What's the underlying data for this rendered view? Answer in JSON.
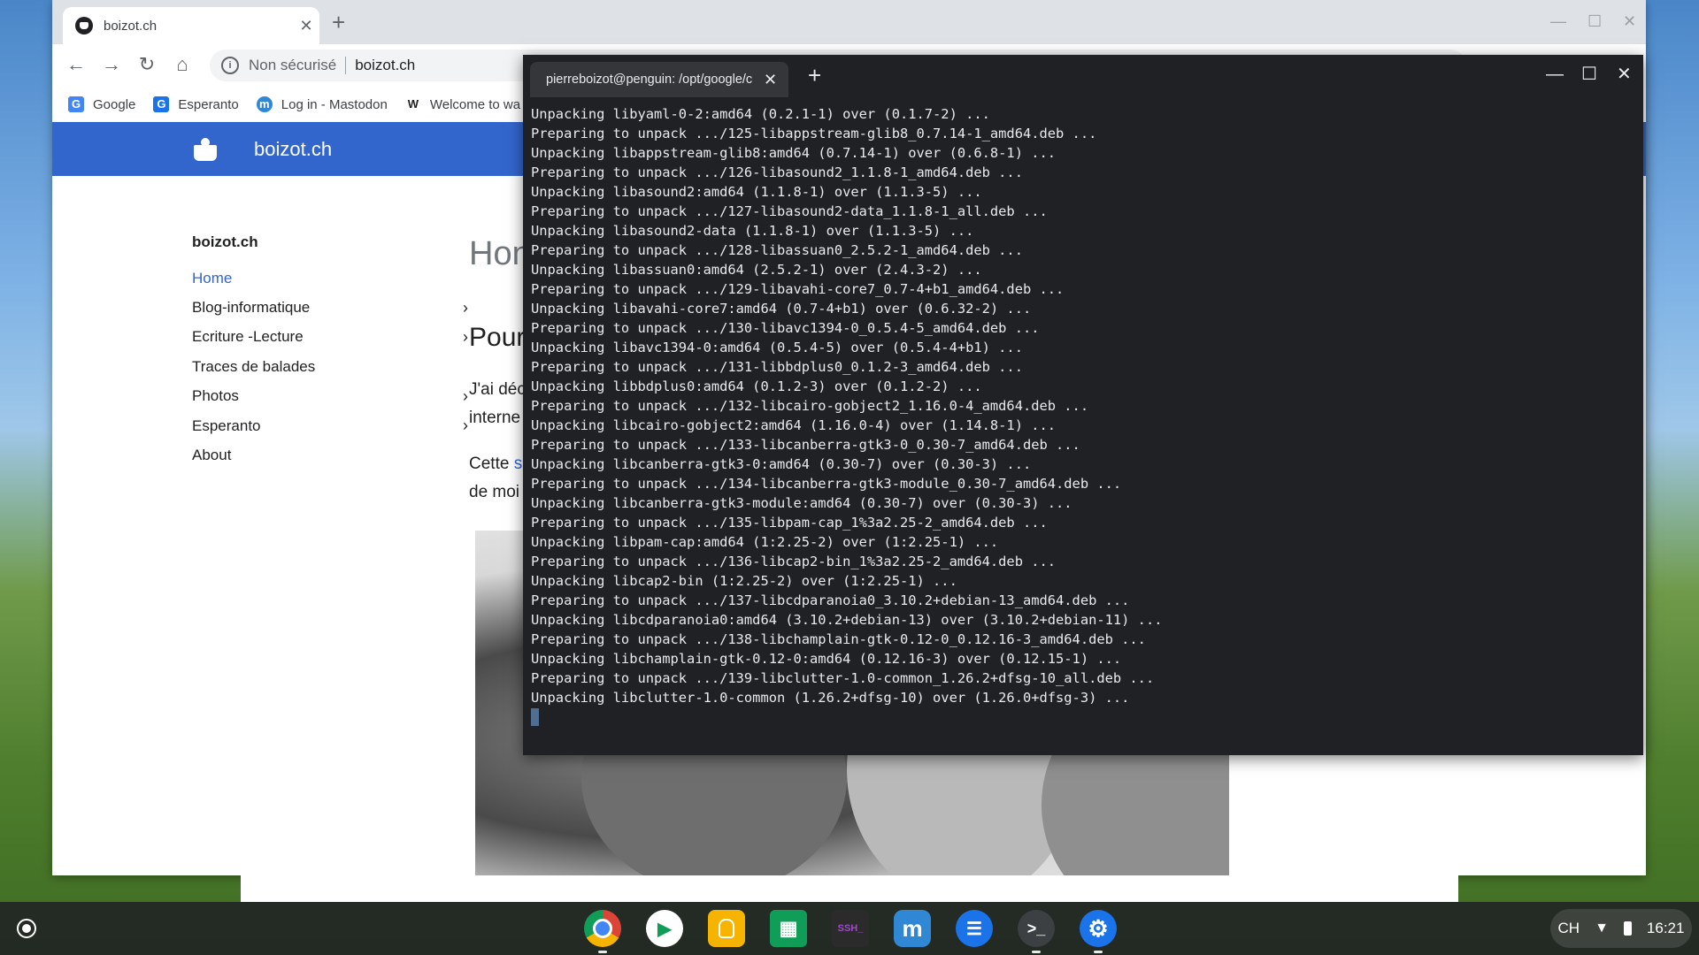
{
  "browser": {
    "tab": {
      "title": "boizot.ch",
      "close": "✕"
    },
    "new_tab": "+",
    "window_controls": {
      "minimize": "—",
      "maximize": "☐",
      "close": "✕"
    },
    "nav": {
      "back": "←",
      "forward": "→",
      "reload": "↻",
      "home": "⌂"
    },
    "omnibox": {
      "security_label": "Non sécurisé",
      "url": "boizot.ch",
      "info_icon": "i"
    },
    "bookmarks": [
      {
        "label": "Google",
        "icon": "G",
        "color": "#4285f4"
      },
      {
        "label": "Esperanto",
        "icon": "G",
        "color": "#1a73e8"
      },
      {
        "label": "Log in - Mastodon",
        "icon": "m",
        "color": "#3088d4"
      },
      {
        "label": "Welcome to wa",
        "icon": "W",
        "color": "#202124"
      }
    ]
  },
  "site": {
    "name": "boizot.ch",
    "header_color": "#3366cc",
    "sidebar": {
      "brand": "boizot.ch",
      "items": [
        {
          "label": "Home",
          "has_children": false,
          "active": true
        },
        {
          "label": "Blog-informatique",
          "has_children": true,
          "active": false
        },
        {
          "label": "Ecriture -Lecture",
          "has_children": true,
          "active": false
        },
        {
          "label": "Traces de balades",
          "has_children": false,
          "active": false
        },
        {
          "label": "Photos",
          "has_children": true,
          "active": false
        },
        {
          "label": "Esperanto",
          "has_children": true,
          "active": false
        },
        {
          "label": "About",
          "has_children": false,
          "active": false
        }
      ],
      "chevron": "›"
    },
    "main": {
      "heading": "Hon",
      "subheading": "Pour",
      "p1": "J'ai déc",
      "p2": "interne",
      "p3_prefix": "Cette ",
      "p3_link": "s",
      "p4": "de moi"
    }
  },
  "terminal": {
    "tab_title": "pierreboizot@penguin: /opt/google/c",
    "close": "✕",
    "new_tab": "+",
    "window_controls": {
      "minimize": "—",
      "maximize": "☐",
      "close": "✕"
    },
    "lines": [
      "Unpacking libyaml-0-2:amd64 (0.2.1-1) over (0.1.7-2) ...",
      "Preparing to unpack .../125-libappstream-glib8_0.7.14-1_amd64.deb ...",
      "Unpacking libappstream-glib8:amd64 (0.7.14-1) over (0.6.8-1) ...",
      "Preparing to unpack .../126-libasound2_1.1.8-1_amd64.deb ...",
      "Unpacking libasound2:amd64 (1.1.8-1) over (1.1.3-5) ...",
      "Preparing to unpack .../127-libasound2-data_1.1.8-1_all.deb ...",
      "Unpacking libasound2-data (1.1.8-1) over (1.1.3-5) ...",
      "Preparing to unpack .../128-libassuan0_2.5.2-1_amd64.deb ...",
      "Unpacking libassuan0:amd64 (2.5.2-1) over (2.4.3-2) ...",
      "Preparing to unpack .../129-libavahi-core7_0.7-4+b1_amd64.deb ...",
      "Unpacking libavahi-core7:amd64 (0.7-4+b1) over (0.6.32-2) ...",
      "Preparing to unpack .../130-libavc1394-0_0.5.4-5_amd64.deb ...",
      "Unpacking libavc1394-0:amd64 (0.5.4-5) over (0.5.4-4+b1) ...",
      "Preparing to unpack .../131-libbdplus0_0.1.2-3_amd64.deb ...",
      "Unpacking libbdplus0:amd64 (0.1.2-3) over (0.1.2-2) ...",
      "Preparing to unpack .../132-libcairo-gobject2_1.16.0-4_amd64.deb ...",
      "Unpacking libcairo-gobject2:amd64 (1.16.0-4) over (1.14.8-1) ...",
      "Preparing to unpack .../133-libcanberra-gtk3-0_0.30-7_amd64.deb ...",
      "Unpacking libcanberra-gtk3-0:amd64 (0.30-7) over (0.30-3) ...",
      "Preparing to unpack .../134-libcanberra-gtk3-module_0.30-7_amd64.deb ...",
      "Unpacking libcanberra-gtk3-module:amd64 (0.30-7) over (0.30-3) ...",
      "Preparing to unpack .../135-libpam-cap_1%3a2.25-2_amd64.deb ...",
      "Unpacking libpam-cap:amd64 (1:2.25-2) over (1:2.25-1) ...",
      "Preparing to unpack .../136-libcap2-bin_1%3a2.25-2_amd64.deb ...",
      "Unpacking libcap2-bin (1:2.25-2) over (1:2.25-1) ...",
      "Preparing to unpack .../137-libcdparanoia0_3.10.2+debian-13_amd64.deb ...",
      "Unpacking libcdparanoia0:amd64 (3.10.2+debian-13) over (3.10.2+debian-11) ...",
      "Preparing to unpack .../138-libchamplain-gtk-0.12-0_0.12.16-3_amd64.deb ...",
      "Unpacking libchamplain-gtk-0.12-0:amd64 (0.12.16-3) over (0.12.15-1) ...",
      "Preparing to unpack .../139-libclutter-1.0-common_1.26.2+dfsg-10_all.deb ...",
      "Unpacking libclutter-1.0-common (1.26.2+dfsg-10) over (1.26.0+dfsg-3) ..."
    ]
  },
  "shelf": {
    "apps": [
      {
        "name": "chrome",
        "icon": "chrome-icon",
        "glyph": "",
        "running": true
      },
      {
        "name": "play-store",
        "icon": "play-store-icon",
        "glyph": "▶",
        "running": false
      },
      {
        "name": "keep",
        "icon": "keep-icon",
        "glyph": "💡",
        "running": false
      },
      {
        "name": "sheets",
        "icon": "sheets-icon",
        "glyph": "▦",
        "running": false
      },
      {
        "name": "ssh",
        "icon": "ssh-icon",
        "glyph": "SSH_",
        "running": false
      },
      {
        "name": "mastodon",
        "icon": "mastodon-icon",
        "glyph": "m",
        "running": false
      },
      {
        "name": "messages",
        "icon": "messages-icon",
        "glyph": "☰",
        "running": false
      },
      {
        "name": "terminal",
        "icon": "terminal-icon",
        "glyph": ">_",
        "running": true
      },
      {
        "name": "settings",
        "icon": "settings-icon",
        "glyph": "⚙",
        "running": true
      }
    ],
    "status": {
      "keyboard": "CH",
      "time": "16:21",
      "wifi": "▼"
    }
  }
}
